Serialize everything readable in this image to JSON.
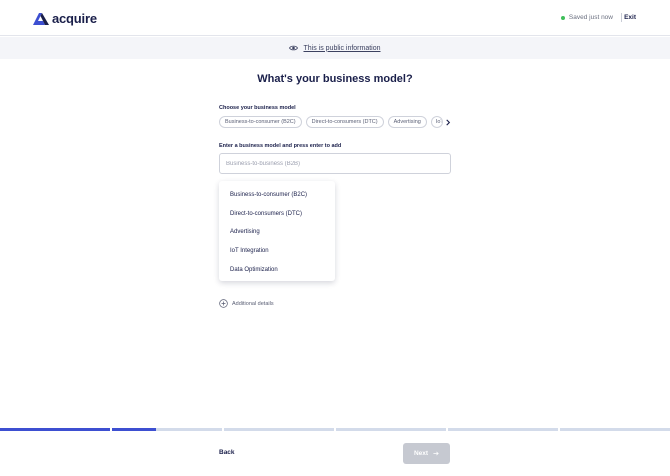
{
  "header": {
    "logo_text": "acquire",
    "saved_status": "Saved just now",
    "exit_label": "Exit"
  },
  "banner": {
    "text": "This is public information"
  },
  "page": {
    "title": "What's your business model?"
  },
  "chips_section": {
    "label": "Choose your business model",
    "chips": [
      "Business-to-consumer (B2C)",
      "Direct-to-consumers (DTC)",
      "Advertising",
      "IoT Integration"
    ]
  },
  "input_section": {
    "label": "Enter a business model and press enter to add",
    "placeholder": "Business-to-business (B2B)",
    "value": ""
  },
  "dropdown": {
    "items": [
      "Business-to-consumer (B2C)",
      "Direct-to-consumers (DTC)",
      "Advertising",
      "IoT Integration",
      "Data Optimization"
    ]
  },
  "additional": {
    "label": "Additional details"
  },
  "progress": {
    "segments": [
      1,
      0.4,
      0,
      0,
      0,
      0
    ]
  },
  "footer": {
    "back_label": "Back",
    "next_label": "Next"
  },
  "colors": {
    "accent": "#3d4fd1",
    "text": "#1a1f4a",
    "saved_dot": "#3fbf5a",
    "disabled_button": "#c6c9d1"
  }
}
